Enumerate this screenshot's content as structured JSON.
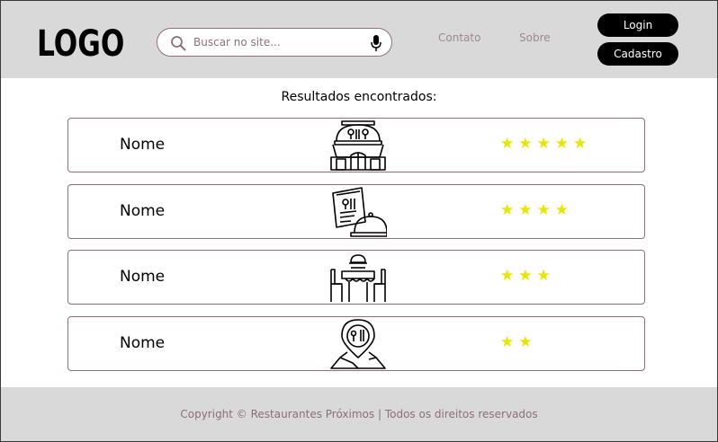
{
  "header": {
    "logo": "LOGO",
    "search": {
      "placeholder": "Buscar no site...",
      "value": ""
    },
    "nav": {
      "contact": "Contato",
      "about": "Sobre"
    },
    "login_label": "Login",
    "signup_label": "Cadastro"
  },
  "main": {
    "title": "Resultados encontrados:",
    "results": [
      {
        "name": "Nome",
        "icon": "restaurant-building-icon",
        "rating": 5,
        "stars": "★★★★★"
      },
      {
        "name": "Nome",
        "icon": "menu-cloche-icon",
        "rating": 4,
        "stars": "★★★★"
      },
      {
        "name": "Nome",
        "icon": "dining-table-icon",
        "rating": 3,
        "stars": "★★★"
      },
      {
        "name": "Nome",
        "icon": "restaurant-location-icon",
        "rating": 2,
        "stars": "★★"
      }
    ]
  },
  "footer": {
    "copyright": "Copyright © Restaurantes Próximos | Todos os direitos reservados"
  },
  "colors": {
    "header_bg": "#d9d9d9",
    "accent": "#8d6f78",
    "star": "#e6e600",
    "button_bg": "#000000"
  }
}
